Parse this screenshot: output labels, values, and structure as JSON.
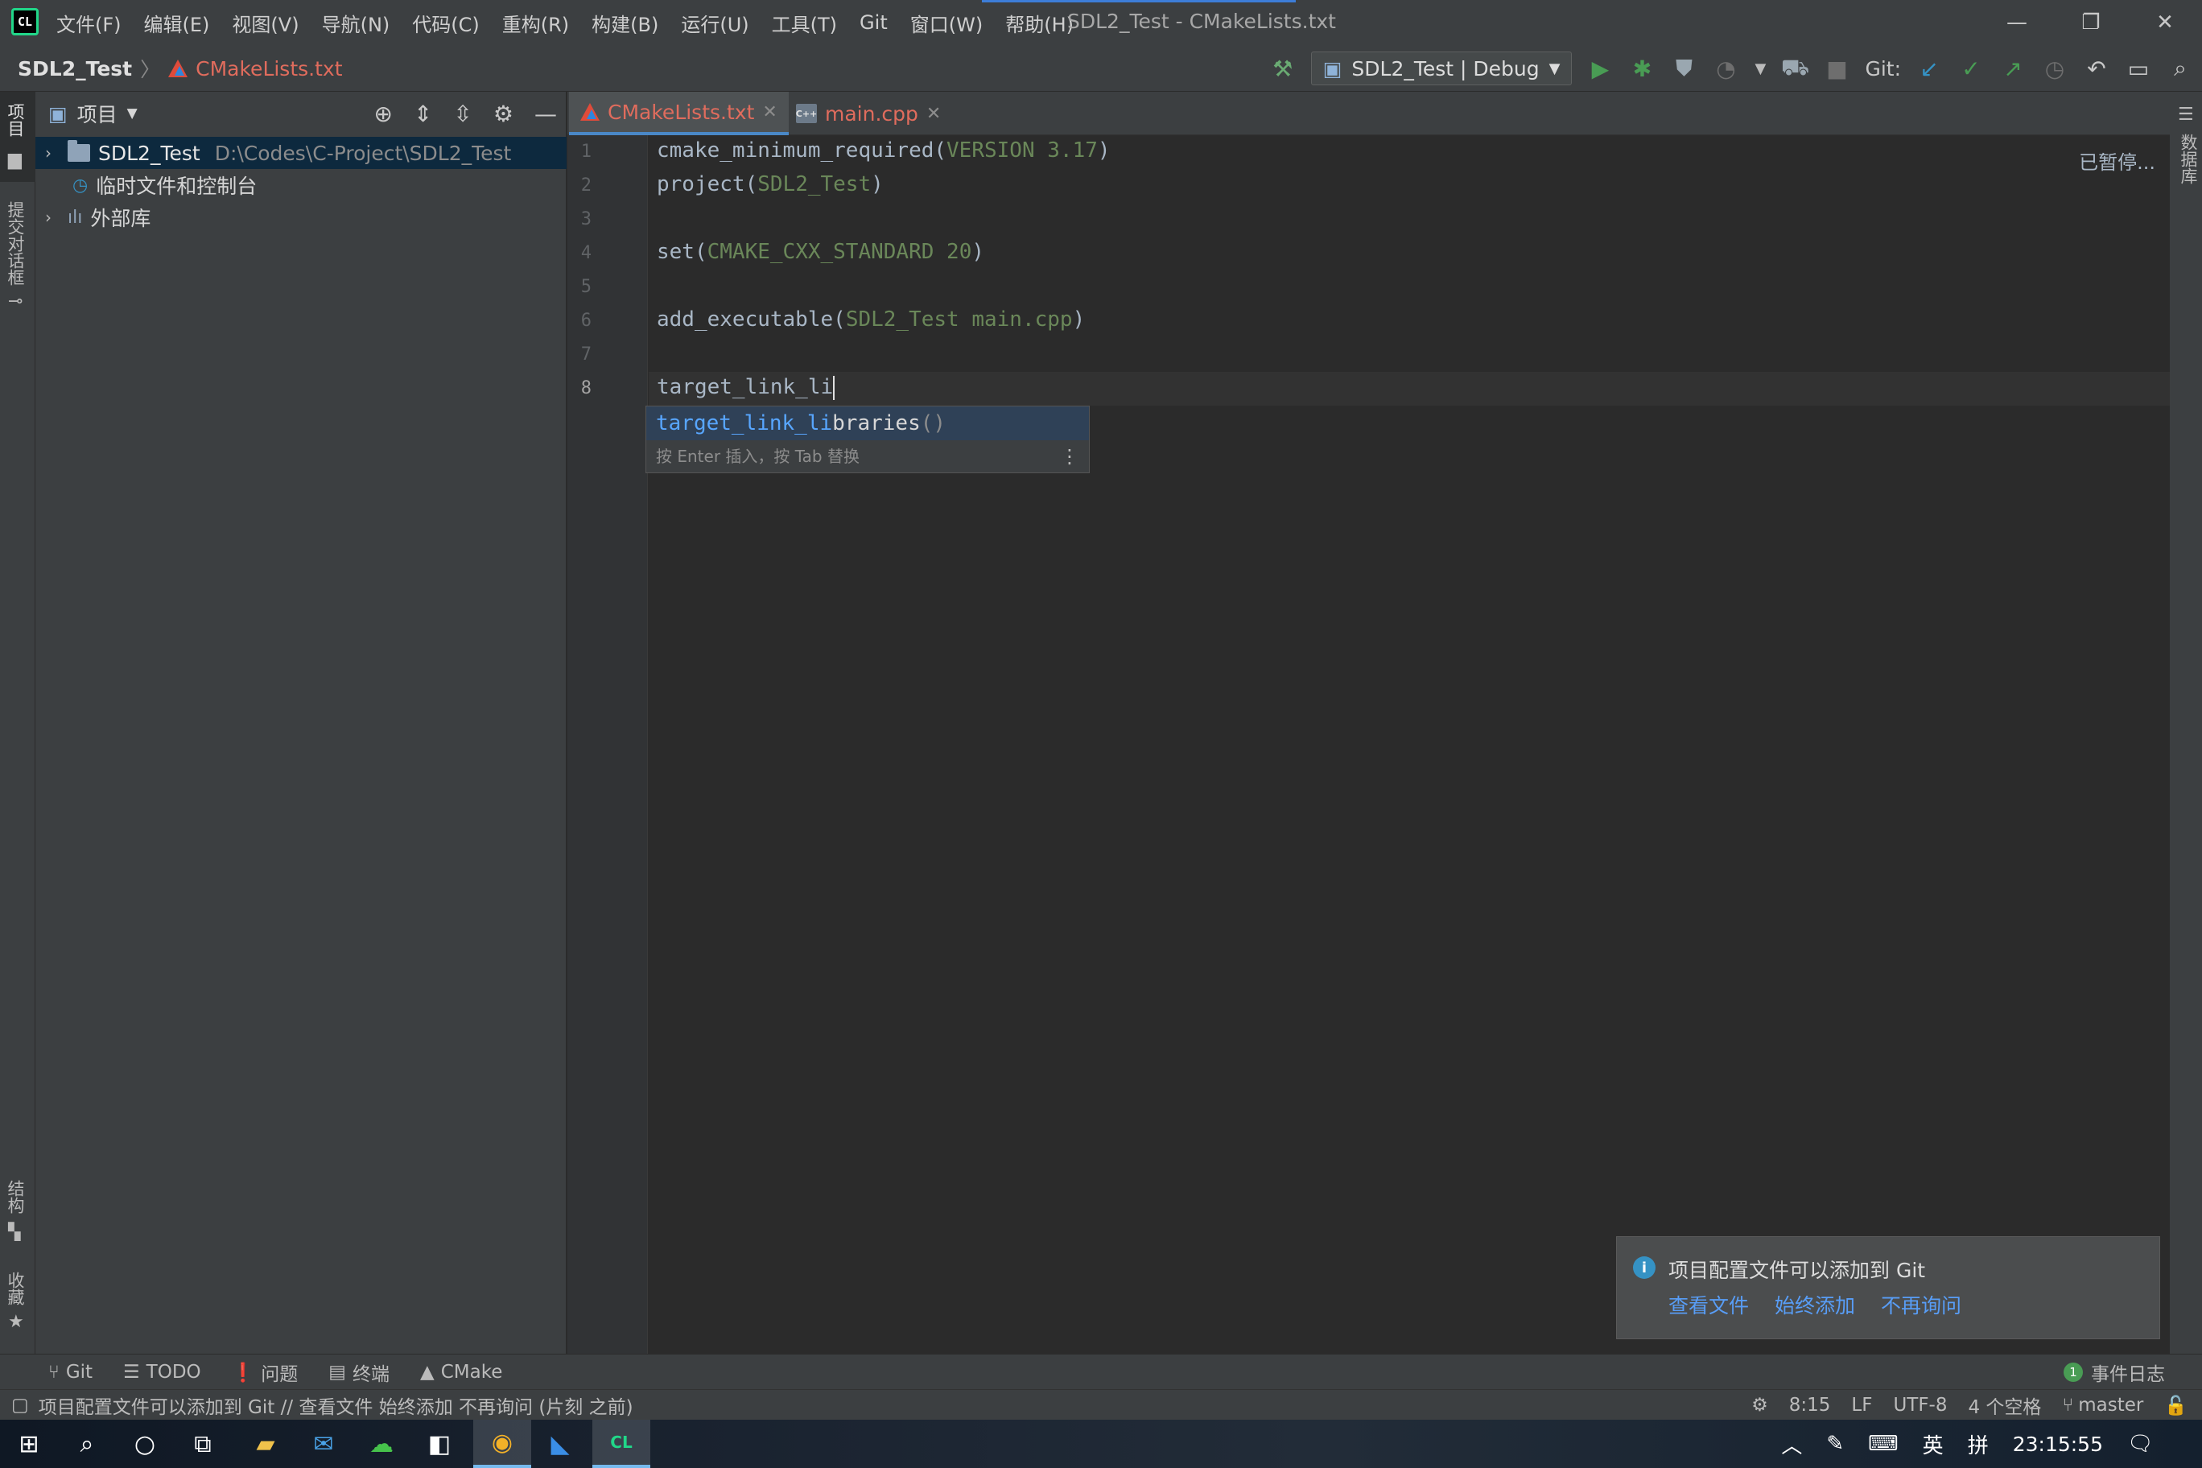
{
  "titlebar": {
    "menu": [
      "文件(F)",
      "编辑(E)",
      "视图(V)",
      "导航(N)",
      "代码(C)",
      "重构(R)",
      "构建(B)",
      "运行(U)",
      "工具(T)",
      "Git",
      "窗口(W)",
      "帮助(H)"
    ],
    "window_title": "SDL2_Test - CMakeLists.txt",
    "controls": {
      "minimize": "—",
      "restore": "❐",
      "close": "✕"
    }
  },
  "navbar": {
    "project": "SDL2_Test",
    "file": "CMakeLists.txt",
    "run_config": "SDL2_Test | Debug",
    "git_label": "Git:"
  },
  "left_strip": {
    "project_tab": "项目",
    "commit_tab": "提交对话框",
    "structure_tab": "结构",
    "favorites_tab": "收藏"
  },
  "right_strip": {
    "database_tab": "数据库"
  },
  "project_panel": {
    "title": "项目",
    "tree": [
      {
        "label": "SDL2_Test",
        "path": "D:\\Codes\\C-Project\\SDL2_Test",
        "expandable": true,
        "selected": true
      },
      {
        "label": "临时文件和控制台",
        "expandable": false
      },
      {
        "label": "外部库",
        "expandable": true
      }
    ]
  },
  "tabs": [
    {
      "label": "CMakeLists.txt",
      "active": true
    },
    {
      "label": "main.cpp",
      "active": false
    }
  ],
  "editor": {
    "line_numbers": [
      "1",
      "2",
      "3",
      "4",
      "5",
      "6",
      "7",
      "8"
    ],
    "lines": [
      {
        "fn": "cmake_minimum_required(",
        "arg": "VERSION 3.17",
        "end": ")"
      },
      {
        "fn": "project(",
        "arg": "SDL2_Test",
        "end": ")"
      },
      {
        "fn": "",
        "arg": "",
        "end": ""
      },
      {
        "fn": "set(",
        "arg": "CMAKE_CXX_STANDARD 20",
        "end": ")"
      },
      {
        "fn": "",
        "arg": "",
        "end": ""
      },
      {
        "fn": "add_executable(",
        "arg": "SDL2_Test main.cpp",
        "end": ")"
      },
      {
        "fn": "",
        "arg": "",
        "end": ""
      },
      {
        "fn": "target_link_li",
        "arg": "",
        "end": ""
      }
    ],
    "paused_label": "已暂停..."
  },
  "completion": {
    "match": "target_link_li",
    "rest": "braries",
    "parens": "()",
    "hint": "按 Enter 插入，按 Tab 替换"
  },
  "notification": {
    "text": "项目配置文件可以添加到 Git",
    "links": [
      "查看文件",
      "始终添加",
      "不再询问"
    ]
  },
  "bottom_tools": {
    "left": [
      "Git",
      "TODO",
      "问题",
      "终端",
      "CMake"
    ],
    "event_count": "1",
    "event_log": "事件日志"
  },
  "statusbar": {
    "message": "项目配置文件可以添加到 Git // 查看文件   始终添加   不再询问 (片刻 之前)",
    "position": "8:15",
    "line_sep": "LF",
    "encoding": "UTF-8",
    "indent": "4 个空格",
    "branch": "master"
  },
  "taskbar": {
    "tray_lang": "英",
    "tray_ime": "拼",
    "clock": "23:15:55"
  },
  "colors": {
    "accent": "#4a88c7",
    "string": "#6a8759",
    "run_green": "#499c54",
    "link": "#589df6"
  }
}
